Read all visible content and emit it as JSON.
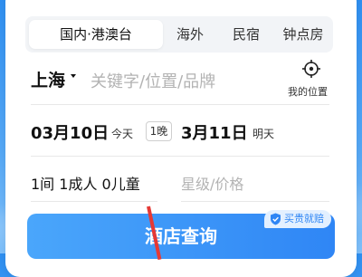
{
  "tabs": [
    {
      "label": "国内·港澳台",
      "active": true
    },
    {
      "label": "海外",
      "active": false
    },
    {
      "label": "民宿",
      "active": false
    },
    {
      "label": "钟点房",
      "active": false
    }
  ],
  "destination": {
    "city": "上海",
    "search_placeholder": "关键字/位置/品牌",
    "my_location_label": "我的位置"
  },
  "dates": {
    "checkin": "03月10日",
    "checkin_sub": "今天",
    "nights": "1晚",
    "checkout": "3月11日",
    "checkout_sub": "明天"
  },
  "guests": {
    "summary": "1间 1成人 0儿童",
    "filter_placeholder": "星级/价格"
  },
  "search_button": {
    "label": "酒店查询",
    "badge": "买贵就赔"
  },
  "colors": {
    "accent": "#2f86f5",
    "background_top": "#2f8ff0"
  },
  "icons": {
    "location": "crosshair-target-icon",
    "caret": "caret-down-icon",
    "badge": "shield-check-icon"
  }
}
